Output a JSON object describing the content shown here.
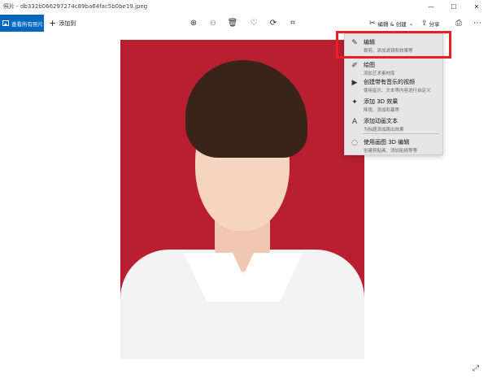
{
  "window": {
    "title": "照片 - db332b066297274c89ba64fac5b0be19.jpeg",
    "minimize_icon": "—",
    "maximize_icon": "☐",
    "close_icon": "✕"
  },
  "toolbar": {
    "view_all_label": "查看所有照片",
    "add_to_label": "添加到",
    "edit_create_label": "编辑 & 创建",
    "share_label": "分享",
    "icons": {
      "zoom_in": "⊕",
      "zoom_out": "⊖",
      "delete": "🗑",
      "favorite": "♡",
      "rotate": "⟳",
      "crop": "⌗",
      "edit_create": "✂",
      "chevron": "⌄",
      "share": "⇪",
      "print": "⎙",
      "more": "⋯"
    }
  },
  "menu": {
    "items": [
      {
        "title": "编辑",
        "desc": "裁剪、添加滤镜和效果等",
        "icon": "✎"
      },
      {
        "title": "绘图",
        "desc": "添加艺术素材库",
        "icon": "✐"
      },
      {
        "title": "创建带有音乐的视频",
        "desc": "使用音乐、文本等内容进行自定义",
        "icon": "▶"
      },
      {
        "title": "添加 3D 效果",
        "desc": "降雨、添加彩幕等",
        "icon": "✦"
      },
      {
        "title": "添加动画文本",
        "desc": "为标题添加跳出效果",
        "icon": "A"
      },
      {
        "title": "使用画图 3D 编辑",
        "desc": "创建剪贴画、添加贴纸等等",
        "icon": "◌"
      }
    ]
  },
  "fullscreen_icon": "⤢",
  "colors": {
    "accent": "#0067c0",
    "highlight_box": "#e8202a",
    "photo_background": "#b91f30"
  }
}
